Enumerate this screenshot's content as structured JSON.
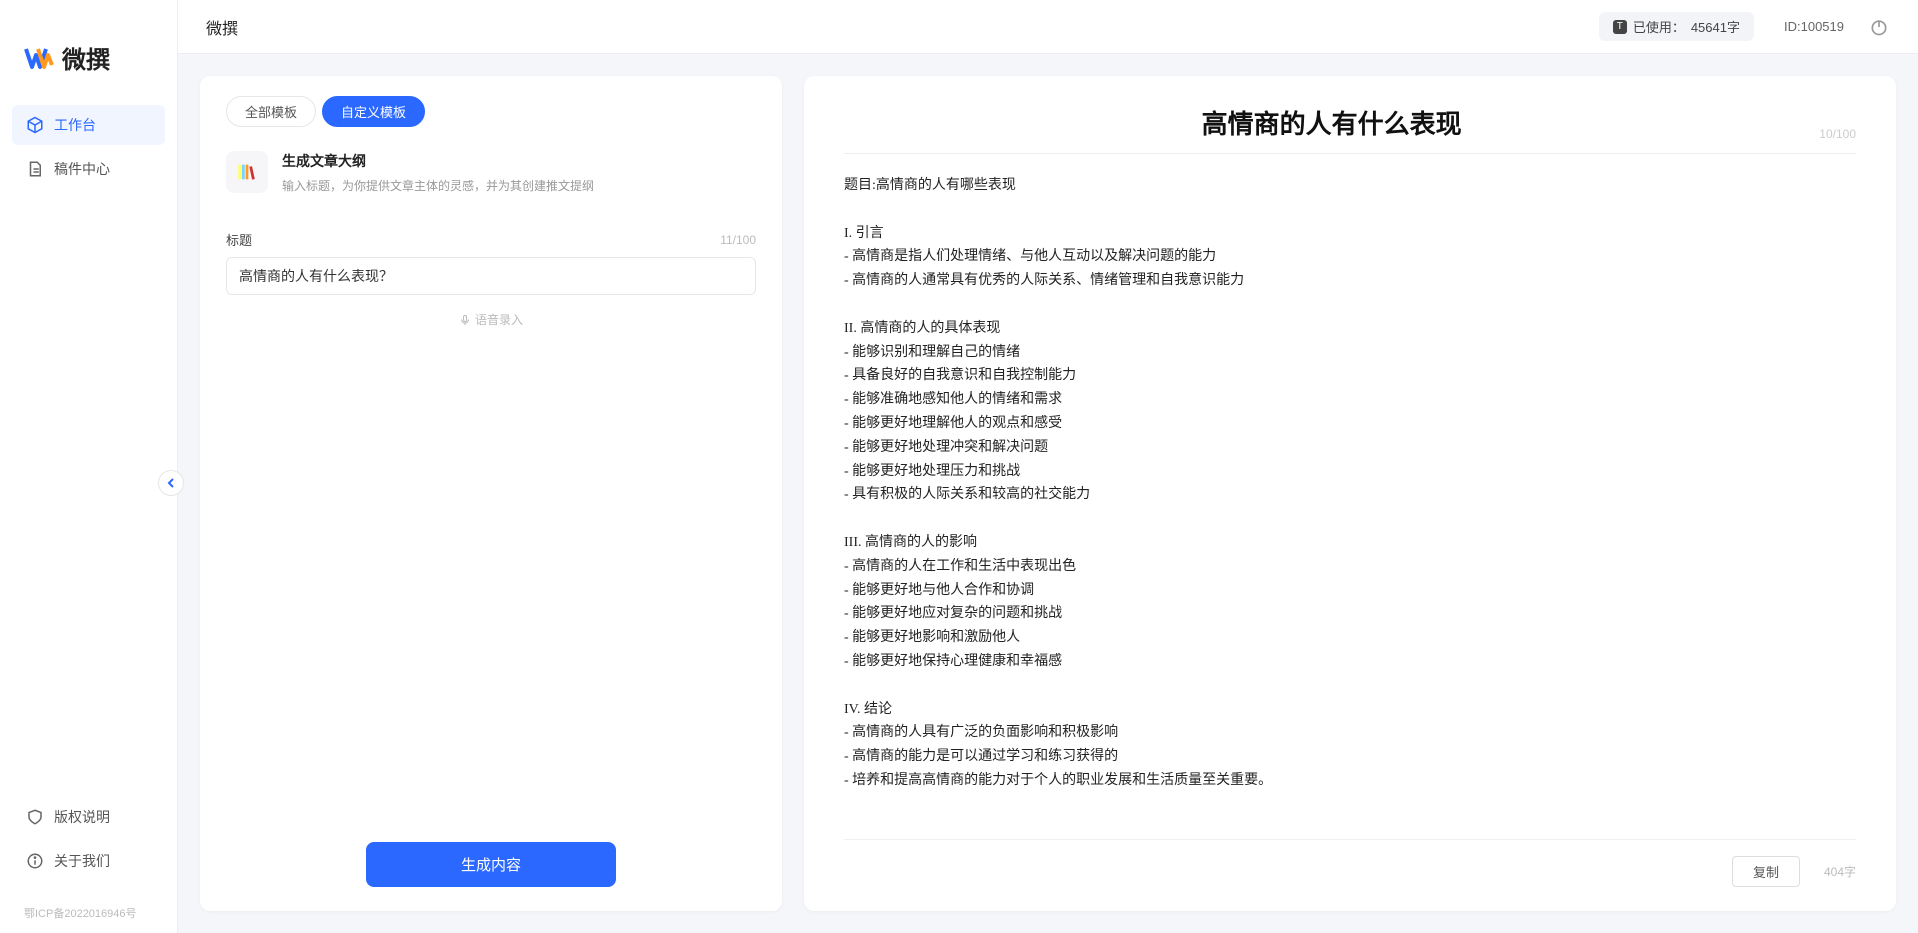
{
  "brand": "微撰",
  "topbar": {
    "title": "微撰",
    "usage_label": "已使用：",
    "usage_value": "45641字",
    "id_label": "ID:",
    "id_value": "100519"
  },
  "sidebar": {
    "items": [
      {
        "label": "工作台"
      },
      {
        "label": "稿件中心"
      }
    ],
    "bottom": [
      {
        "label": "版权说明"
      },
      {
        "label": "关于我们"
      }
    ],
    "icp": "鄂ICP备2022016946号"
  },
  "tabs": {
    "all": "全部模板",
    "custom": "自定义模板"
  },
  "template": {
    "title": "生成文章大纲",
    "desc": "输入标题，为你提供文章主体的灵感，并为其创建推文提纲"
  },
  "form": {
    "title_label": "标题",
    "title_value": "高情商的人有什么表现？",
    "title_counter": "11/100",
    "voice_hint": "语音录入",
    "generate_label": "生成内容"
  },
  "output": {
    "title": "高情商的人有什么表现",
    "title_counter": "10/100",
    "body": "题目:高情商的人有哪些表现\n\nI. 引言\n- 高情商是指人们处理情绪、与他人互动以及解决问题的能力\n- 高情商的人通常具有优秀的人际关系、情绪管理和自我意识能力\n\nII. 高情商的人的具体表现\n- 能够识别和理解自己的情绪\n- 具备良好的自我意识和自我控制能力\n- 能够准确地感知他人的情绪和需求\n- 能够更好地理解他人的观点和感受\n- 能够更好地处理冲突和解决问题\n- 能够更好地处理压力和挑战\n- 具有积极的人际关系和较高的社交能力\n\nIII. 高情商的人的影响\n- 高情商的人在工作和生活中表现出色\n- 能够更好地与他人合作和协调\n- 能够更好地应对复杂的问题和挑战\n- 能够更好地影响和激励他人\n- 能够更好地保持心理健康和幸福感\n\nIV. 结论\n- 高情商的人具有广泛的负面影响和积极影响\n- 高情商的能力是可以通过学习和练习获得的\n- 培养和提高高情商的能力对于个人的职业发展和生活质量至关重要。",
    "copy_label": "复制",
    "char_count": "404字"
  }
}
